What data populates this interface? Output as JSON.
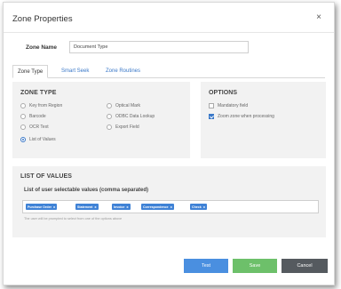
{
  "dialog": {
    "title": "Zone Properties",
    "close_glyph": "×"
  },
  "zone_name": {
    "label": "Zone Name",
    "value": "Document Type"
  },
  "tabs": [
    {
      "label": "Zone Type",
      "active": true
    },
    {
      "label": "Smart Seek",
      "active": false
    },
    {
      "label": "Zone Routines",
      "active": false
    }
  ],
  "zone_type": {
    "title": "ZONE TYPE",
    "options": [
      {
        "label": "Key from Region",
        "selected": false
      },
      {
        "label": "Barcode",
        "selected": false
      },
      {
        "label": "OCR Text",
        "selected": false
      },
      {
        "label": "List of Values",
        "selected": true
      },
      {
        "label": "Optical Mark",
        "selected": false
      },
      {
        "label": "ODBC Data Lookup",
        "selected": false
      },
      {
        "label": "Export Field",
        "selected": false
      }
    ]
  },
  "options": {
    "title": "OPTIONS",
    "items": [
      {
        "label": "Mandatory field",
        "checked": false
      },
      {
        "label": "Zoom zone when processing",
        "checked": true
      }
    ]
  },
  "list_of_values": {
    "title": "LIST OF VALUES",
    "subtitle": "List of user selectable values (comma separated)",
    "tags": [
      "Purchase Order",
      "Statement",
      "Invoice",
      "Correspondence",
      "Check"
    ],
    "tag_remove_glyph": "x",
    "help_text": "The user will be prompted to select from one of the options above"
  },
  "buttons": {
    "test": "Test",
    "save": "Save",
    "cancel": "Cancel"
  },
  "colors": {
    "accent": "#3a78c8",
    "tag": "#3f82d6",
    "save": "#6dc06a",
    "cancel": "#555a5f",
    "panel": "#f2f2f2"
  }
}
